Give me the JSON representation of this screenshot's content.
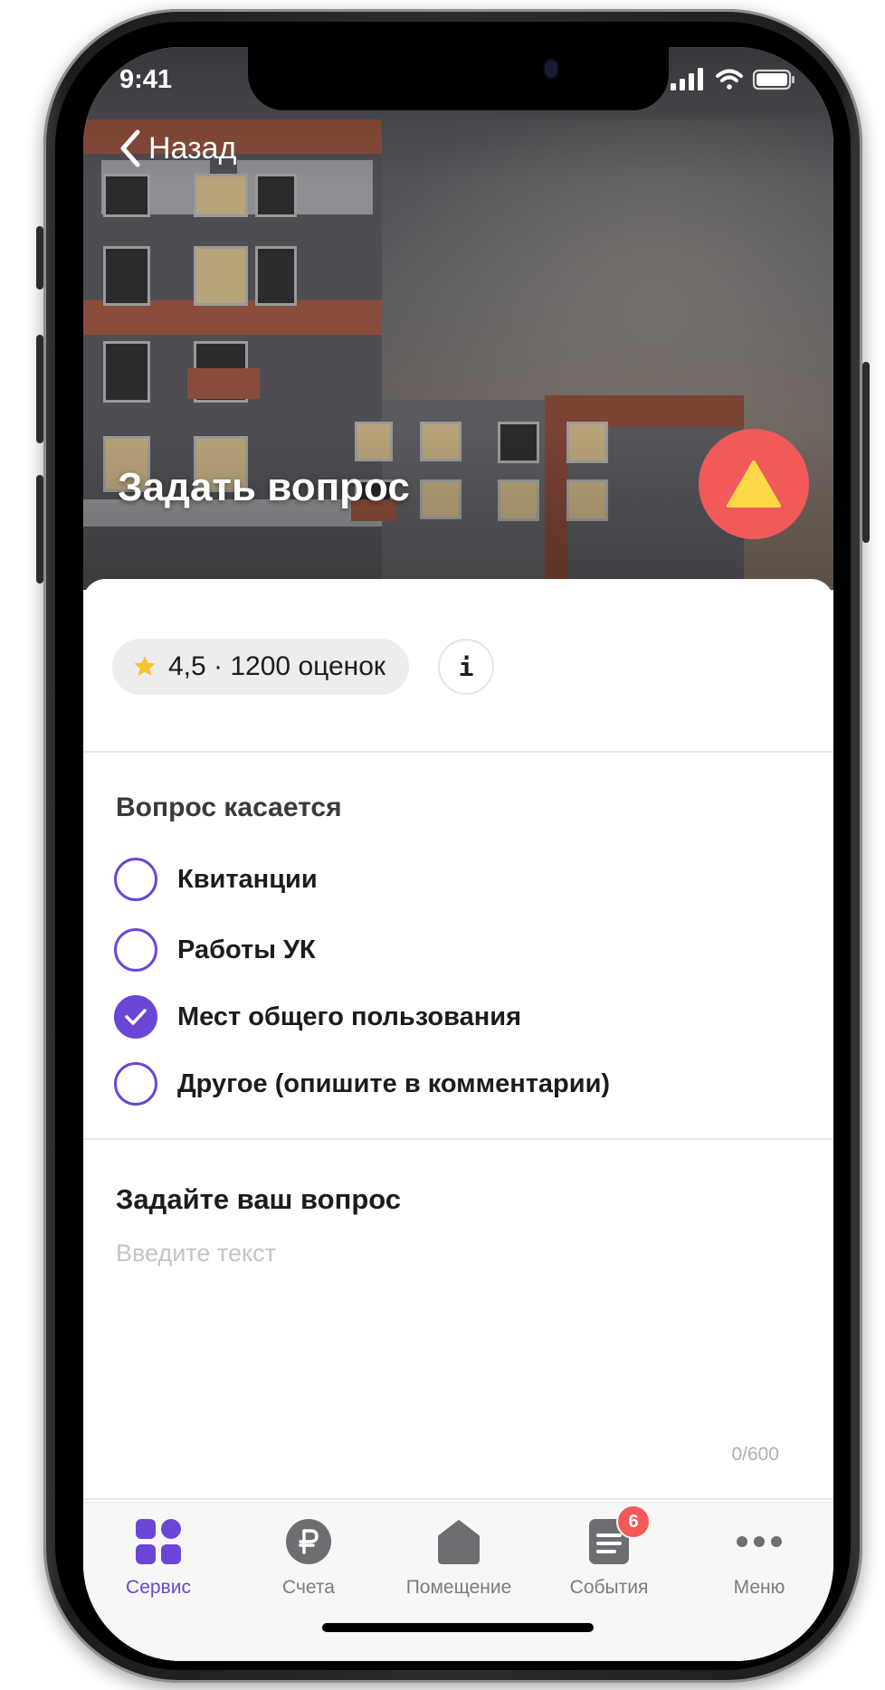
{
  "status_bar": {
    "time": "9:41"
  },
  "nav": {
    "back_label": "Назад"
  },
  "hero": {
    "title": "Задать вопрос"
  },
  "rating": {
    "text": "4,5 · 1200 оценок",
    "info_label": "i"
  },
  "topic": {
    "title": "Вопрос касается",
    "options": [
      {
        "label": "Квитанции",
        "checked": false
      },
      {
        "label": "Работы УК",
        "checked": false
      },
      {
        "label": "Мест общего пользования",
        "checked": true
      },
      {
        "label": "Другое (опишите в комментарии)",
        "checked": false
      }
    ]
  },
  "question": {
    "title": "Задайте ваш вопрос",
    "placeholder": "Введите текст",
    "counter": "0/600"
  },
  "tabbar": {
    "items": [
      {
        "label": "Сервис",
        "icon": "services-grid-icon",
        "active": true
      },
      {
        "label": "Счета",
        "icon": "ruble-icon",
        "active": false
      },
      {
        "label": "Помещение",
        "icon": "home-icon",
        "active": false
      },
      {
        "label": "События",
        "icon": "events-document-icon",
        "active": false,
        "badge": "6"
      },
      {
        "label": "Меню",
        "icon": "more-dots-icon",
        "active": false
      }
    ]
  },
  "colors": {
    "accent": "#6b46d6",
    "fab": "#f25a5a",
    "fab_icon": "#ffd84a",
    "badge": "#f25a5a"
  }
}
